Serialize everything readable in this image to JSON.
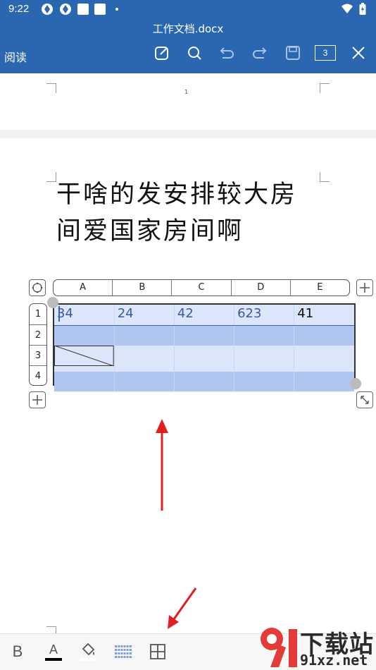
{
  "status_bar": {
    "time": "9:22"
  },
  "toolbar": {
    "title": "工作文档.docx",
    "read_mode": "阅读",
    "page_count": "3",
    "icons": [
      "edit-icon",
      "search-icon",
      "undo-icon",
      "redo-icon",
      "save-icon",
      "page-count-icon",
      "close-icon"
    ]
  },
  "document": {
    "page_number": "1",
    "body_line1": "干啥的发安排较大房",
    "body_line2": "间爱国家房间啊",
    "table": {
      "columns": [
        "A",
        "B",
        "C",
        "D",
        "E"
      ],
      "rows": [
        "1",
        "2",
        "3",
        "4"
      ],
      "cells": [
        [
          "34",
          "24",
          "42",
          "623",
          "41"
        ],
        [
          "",
          "",
          "",
          "",
          ""
        ],
        [
          "",
          "",
          "",
          "",
          ""
        ],
        [
          "",
          "",
          "",
          "",
          ""
        ]
      ]
    }
  },
  "bottom_toolbar": {
    "bold": "B",
    "font_color": "A",
    "icons": [
      "bold-icon",
      "font-color-icon",
      "fill-color-icon",
      "table-style-icon",
      "table-border-icon"
    ]
  },
  "watermark": {
    "brand": "下载站",
    "domain": "91xz.net"
  },
  "colors": {
    "toolbar": "#2b67b1",
    "table_row_dark": "#afc6f1",
    "table_row_light": "#dbe6fb",
    "arrow": "#e02020"
  }
}
